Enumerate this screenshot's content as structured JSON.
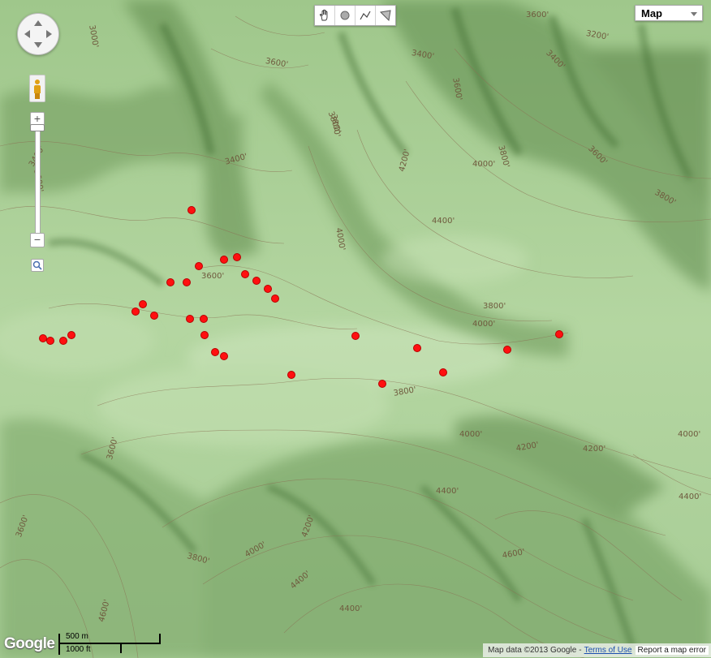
{
  "map": {
    "type_selector": {
      "label": "Map"
    },
    "contour_labels": [
      "3000'",
      "3600'",
      "3400'",
      "3800'",
      "3600'",
      "3400'",
      "3200'",
      "3400'",
      "3600'",
      "3800'",
      "4000'",
      "4200'",
      "3800'",
      "3600'",
      "3800'",
      "4400'",
      "4000'",
      "3800'",
      "4000'",
      "4200'",
      "4000'",
      "3800'",
      "3600'",
      "3600'",
      "3800'",
      "4000'",
      "4200'",
      "4000'",
      "4200'",
      "4400'",
      "4400'",
      "4400'",
      "4600'",
      "4600'",
      "3600'",
      "3400'",
      "3600'",
      "4400'"
    ],
    "markers_count": 31
  },
  "drawing_tools": [
    {
      "name": "hand",
      "icon": "hand-icon"
    },
    {
      "name": "marker",
      "icon": "circle-marker-icon"
    },
    {
      "name": "polyline",
      "icon": "line-icon"
    },
    {
      "name": "polygon",
      "icon": "polygon-icon"
    }
  ],
  "scale": {
    "metric": "500 m",
    "imperial": "1000 ft"
  },
  "logo": "Google",
  "attribution": {
    "map_data": "Map data ©2013 Google",
    "terms": "Terms of Use",
    "report": "Report a map error"
  },
  "colors": {
    "terrain": "#a9cf97",
    "marker": "#ff1010",
    "contour": "#8b7355"
  }
}
